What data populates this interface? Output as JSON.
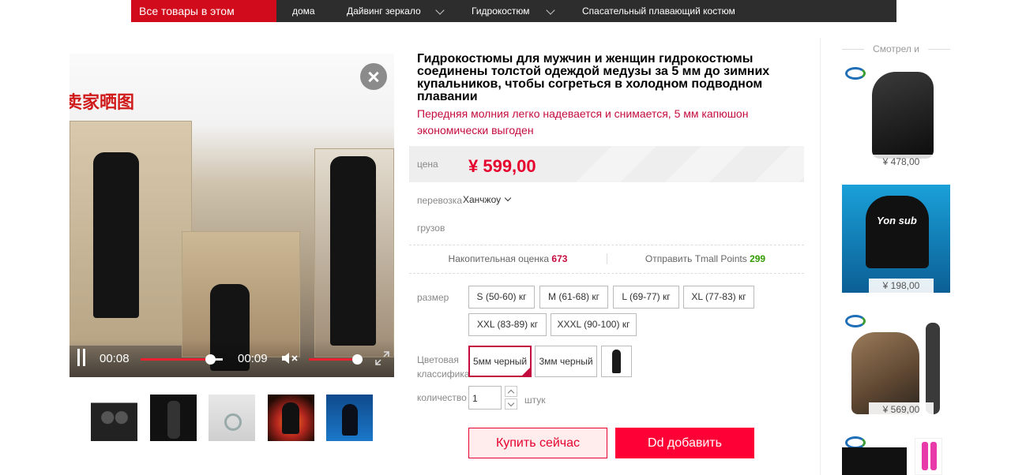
{
  "nav": {
    "all_categories": "Все товары в этом",
    "items": [
      "дома",
      "Дайвинг зеркало",
      "Гидрокостюм",
      "Спасательный плавающий костюм"
    ]
  },
  "video": {
    "current_time": "00:08",
    "duration": "00:09",
    "progress": 0.85,
    "volume": 0.9
  },
  "product": {
    "title": "Гидрокостюмы для мужчин и женщин гидрокостюмы соединены толстой одеждой медузы за 5 мм до зимних купальников, чтобы согреться в холодном подводном плавании",
    "subtitle": "Передняя молния легко надевается и снимается, 5 мм капюшон экономически выгоден",
    "price_label": "цена",
    "price": "¥ 599,00",
    "shipping_label": "перевозка",
    "shipping_value": "Ханчжоу",
    "cargo_label": "грузов",
    "rating_label": "Накопительная оценка",
    "rating_value": "673",
    "points_label": "Отправить Tmall Points",
    "points_value": "299",
    "size_label": "размер",
    "sizes": [
      "S (50-60) кг",
      "M (61-68) кг",
      "L (69-77) кг",
      "XL (77-83) кг",
      "XXL (83-89) кг",
      "XXXL (90-100) кг"
    ],
    "color_label": "Цветовая классифика",
    "colors": [
      "5мм черный",
      "3мм черный"
    ],
    "selected_color": "5мм черный",
    "quantity_label": "количество",
    "quantity": "1",
    "unit": "штук",
    "buy_now": "Купить сейчас",
    "add_to_cart": "Dd добавить"
  },
  "sidebar": {
    "heading": "Смотрел и",
    "items": [
      {
        "price": "¥ 478,00"
      },
      {
        "price": "¥ 198,00",
        "brand": "Yon sub"
      },
      {
        "price": "¥ 569,00"
      }
    ]
  },
  "colors": {
    "brand_red": "#d20b1c",
    "accent": "#c40b3e",
    "price_red": "#e5002d",
    "cart_red": "#ff0036",
    "points_green": "#329b00",
    "nav_dark": "#2d2d2d"
  }
}
